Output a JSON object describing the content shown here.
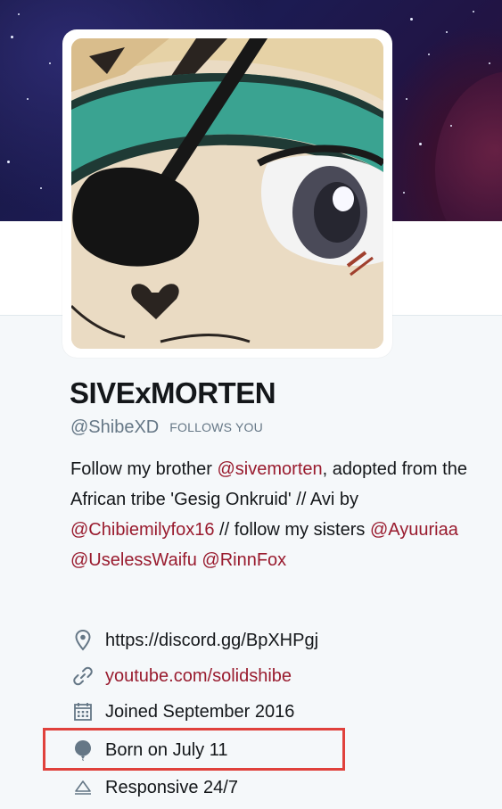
{
  "profile": {
    "display_name": "SIVExMORTEN",
    "handle": "@ShibeXD",
    "follows_badge": "FOLLOWS YOU",
    "bio": {
      "t1": "Follow my brother ",
      "m1": "@sivemorten",
      "t2": ", adopted from the African tribe 'Gesig Onkruid' // Avi by ",
      "m2": "@Chibiemilyfox16",
      "t3": " // follow my sisters ",
      "m3": "@Ayuuriaa",
      "t4": " ",
      "m4": "@UselessWaifu",
      "t5": " ",
      "m5": "@RinnFox"
    },
    "location": "https://discord.gg/BpXHPgj",
    "website": "youtube.com/solidshibe",
    "joined": "Joined September 2016",
    "birthday": "Born on July 11",
    "extra": "Responsive 24/7"
  },
  "icons": {
    "location": "location-pin-icon",
    "website": "link-icon",
    "joined": "calendar-icon",
    "birthday": "balloon-icon",
    "extra": "bell-icon"
  },
  "colors": {
    "link": "#991b2e",
    "text": "#14171a",
    "muted": "#657786",
    "highlight": "#e0413c"
  }
}
